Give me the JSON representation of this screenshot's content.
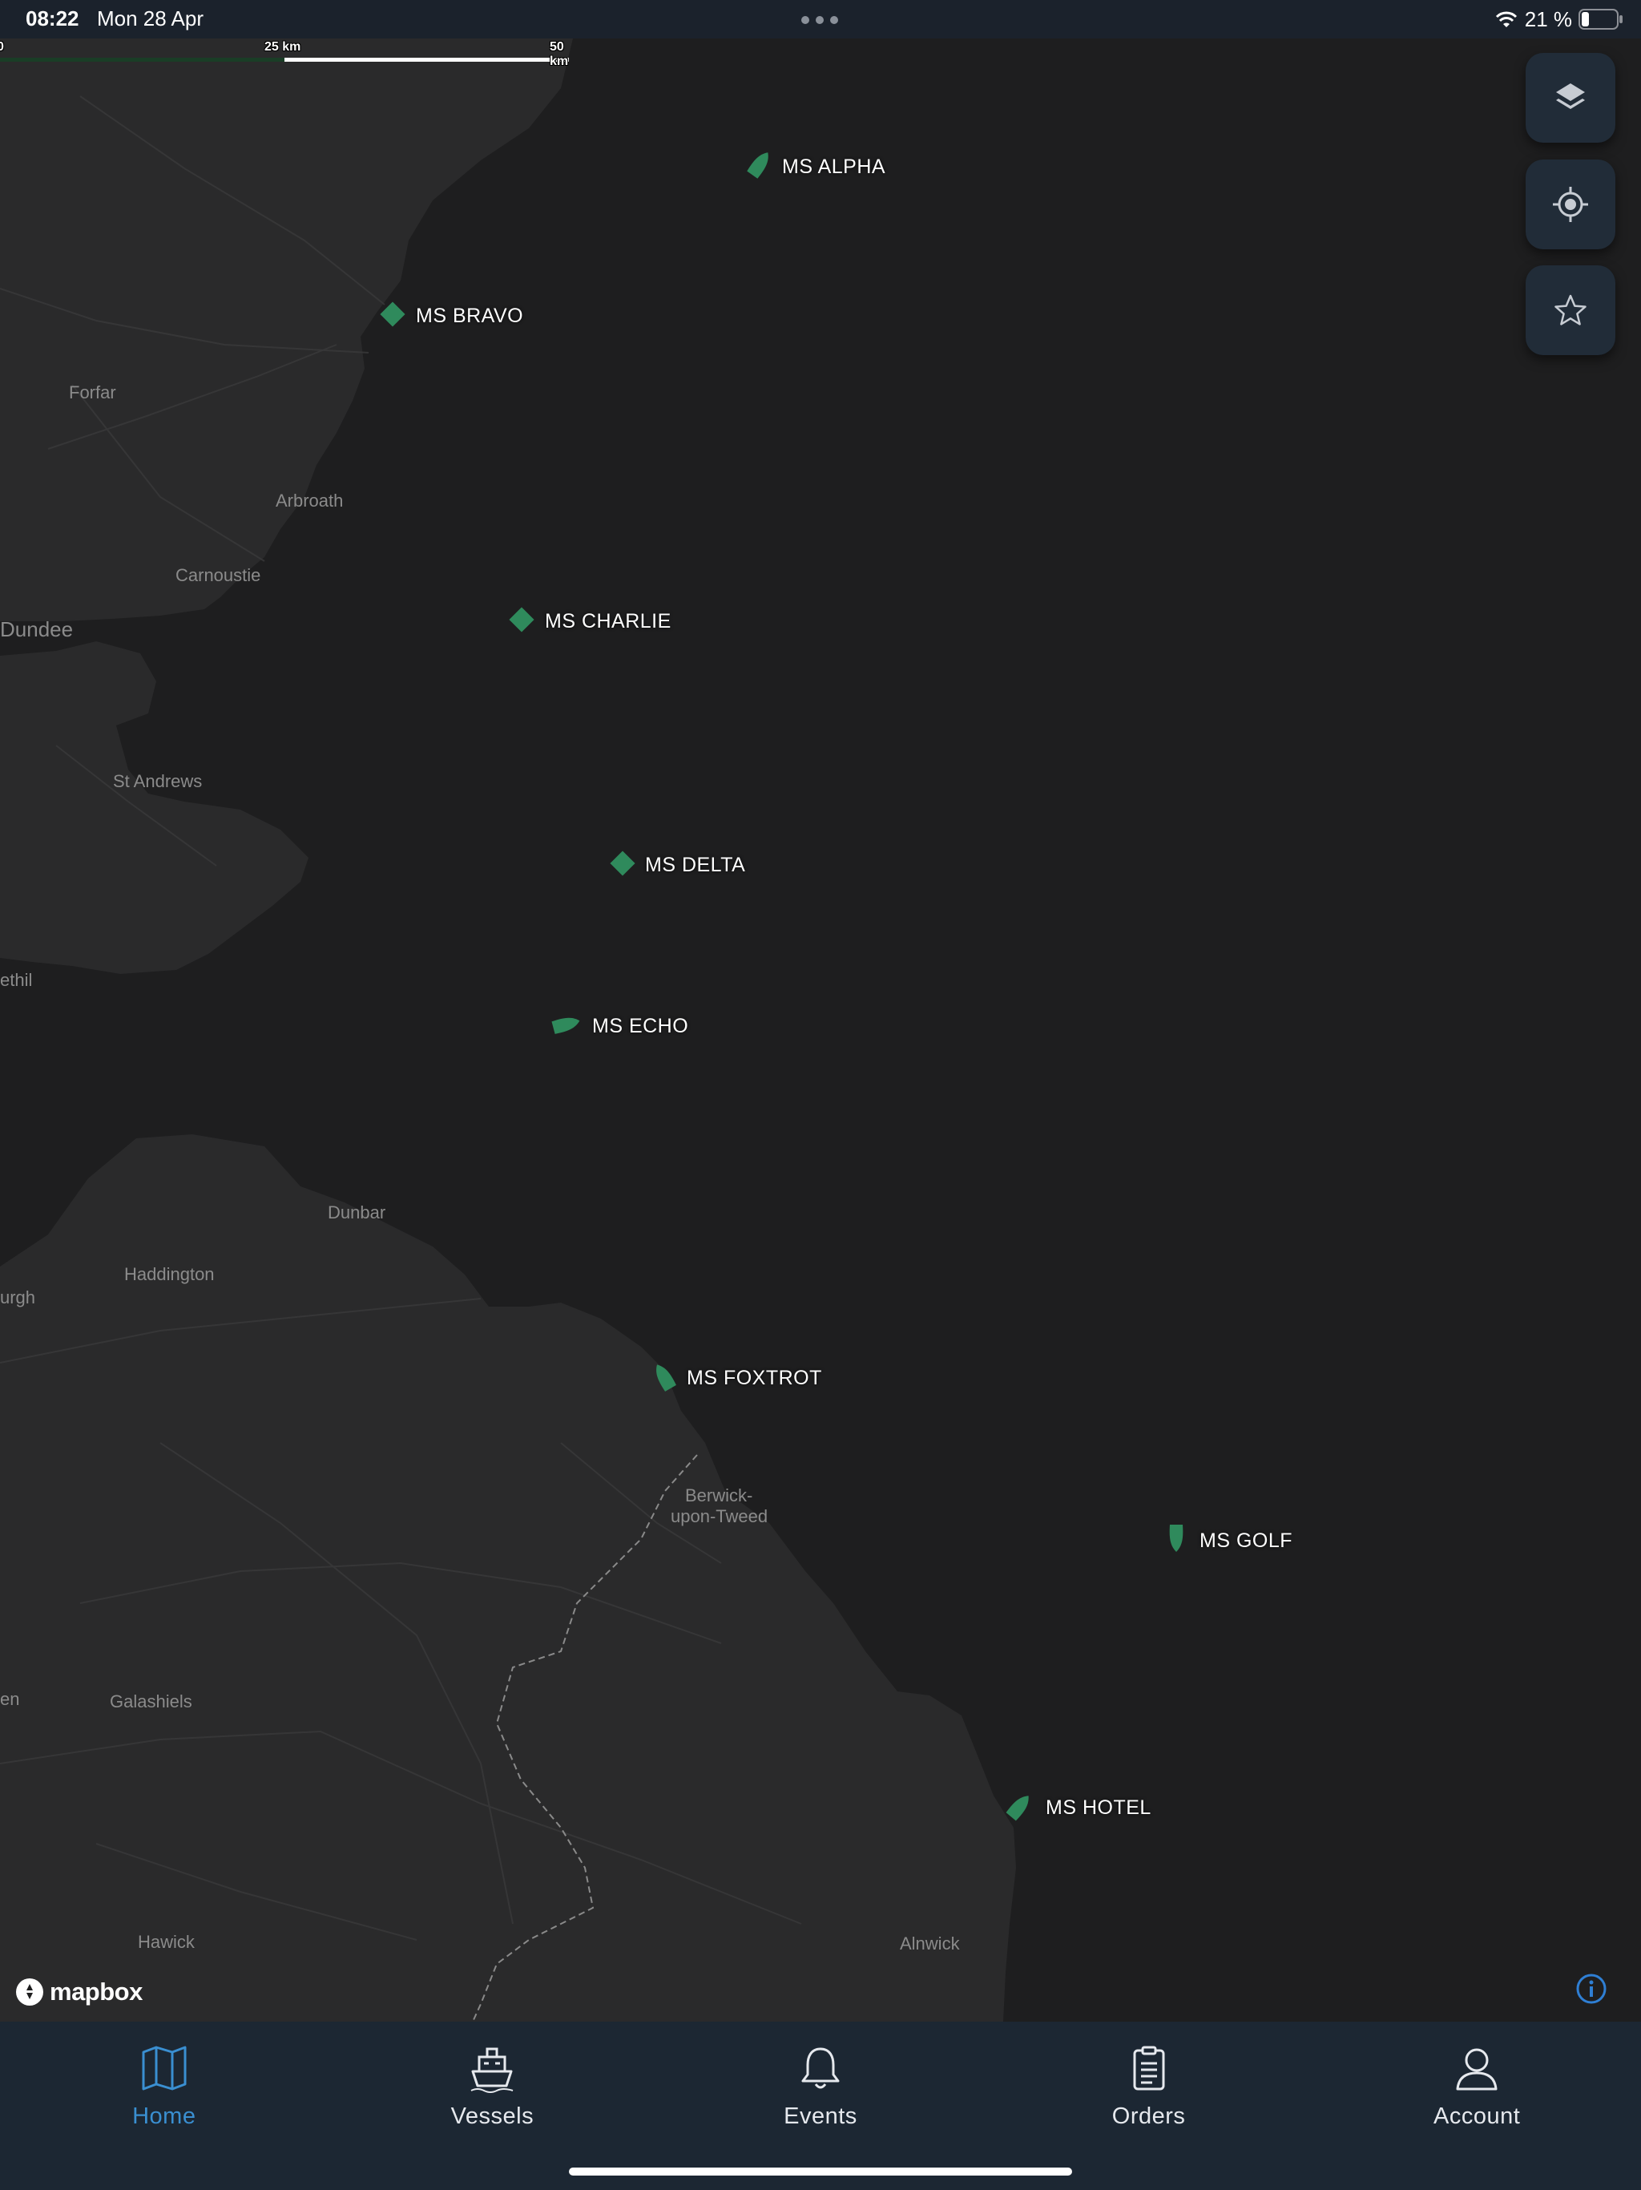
{
  "status_bar": {
    "time": "08:22",
    "date": "Mon 28 Apr",
    "battery": "21 %",
    "icons": [
      "wifi-icon",
      "battery-icon"
    ]
  },
  "scale_bar": {
    "labels": [
      "0",
      "25 km",
      "50 km"
    ]
  },
  "map_controls": [
    "layers-icon",
    "locate-icon",
    "star-icon"
  ],
  "places": [
    {
      "name": "Forfar"
    },
    {
      "name": "Arbroath"
    },
    {
      "name": "Carnoustie"
    },
    {
      "name": "Dundee"
    },
    {
      "name": "St Andrews"
    },
    {
      "name": "ethil"
    },
    {
      "name": "Dunbar"
    },
    {
      "name": "Haddington"
    },
    {
      "name": "urgh"
    },
    {
      "name": "Berwick-"
    },
    {
      "name": "upon-Tweed"
    },
    {
      "name": "en"
    },
    {
      "name": "Galashiels"
    },
    {
      "name": "Hawick"
    },
    {
      "name": "Alnwick"
    }
  ],
  "vessels": [
    {
      "name": "MS ALPHA",
      "status": "underway"
    },
    {
      "name": "MS BRAVO",
      "status": "stationary"
    },
    {
      "name": "MS CHARLIE",
      "status": "stationary"
    },
    {
      "name": "MS DELTA",
      "status": "stationary"
    },
    {
      "name": "MS ECHO",
      "status": "underway"
    },
    {
      "name": "MS FOXTROT",
      "status": "underway"
    },
    {
      "name": "MS GOLF",
      "status": "underway"
    },
    {
      "name": "MS HOTEL",
      "status": "underway"
    }
  ],
  "attribution": {
    "logo": "mapbox",
    "info_icon": "info-icon"
  },
  "tabs": [
    {
      "label": "Home",
      "icon": "map-icon",
      "active": true
    },
    {
      "label": "Vessels",
      "icon": "ship-icon",
      "active": false
    },
    {
      "label": "Events",
      "icon": "bell-icon",
      "active": false
    },
    {
      "label": "Orders",
      "icon": "clipboard-icon",
      "active": false
    },
    {
      "label": "Account",
      "icon": "user-icon",
      "active": false
    }
  ],
  "colors": {
    "sea": "#1e1e1f",
    "land": "#2a2a2b",
    "vessel": "#2f8a5c",
    "accent": "#3a8fd1",
    "tabbar": "#1c2733"
  }
}
